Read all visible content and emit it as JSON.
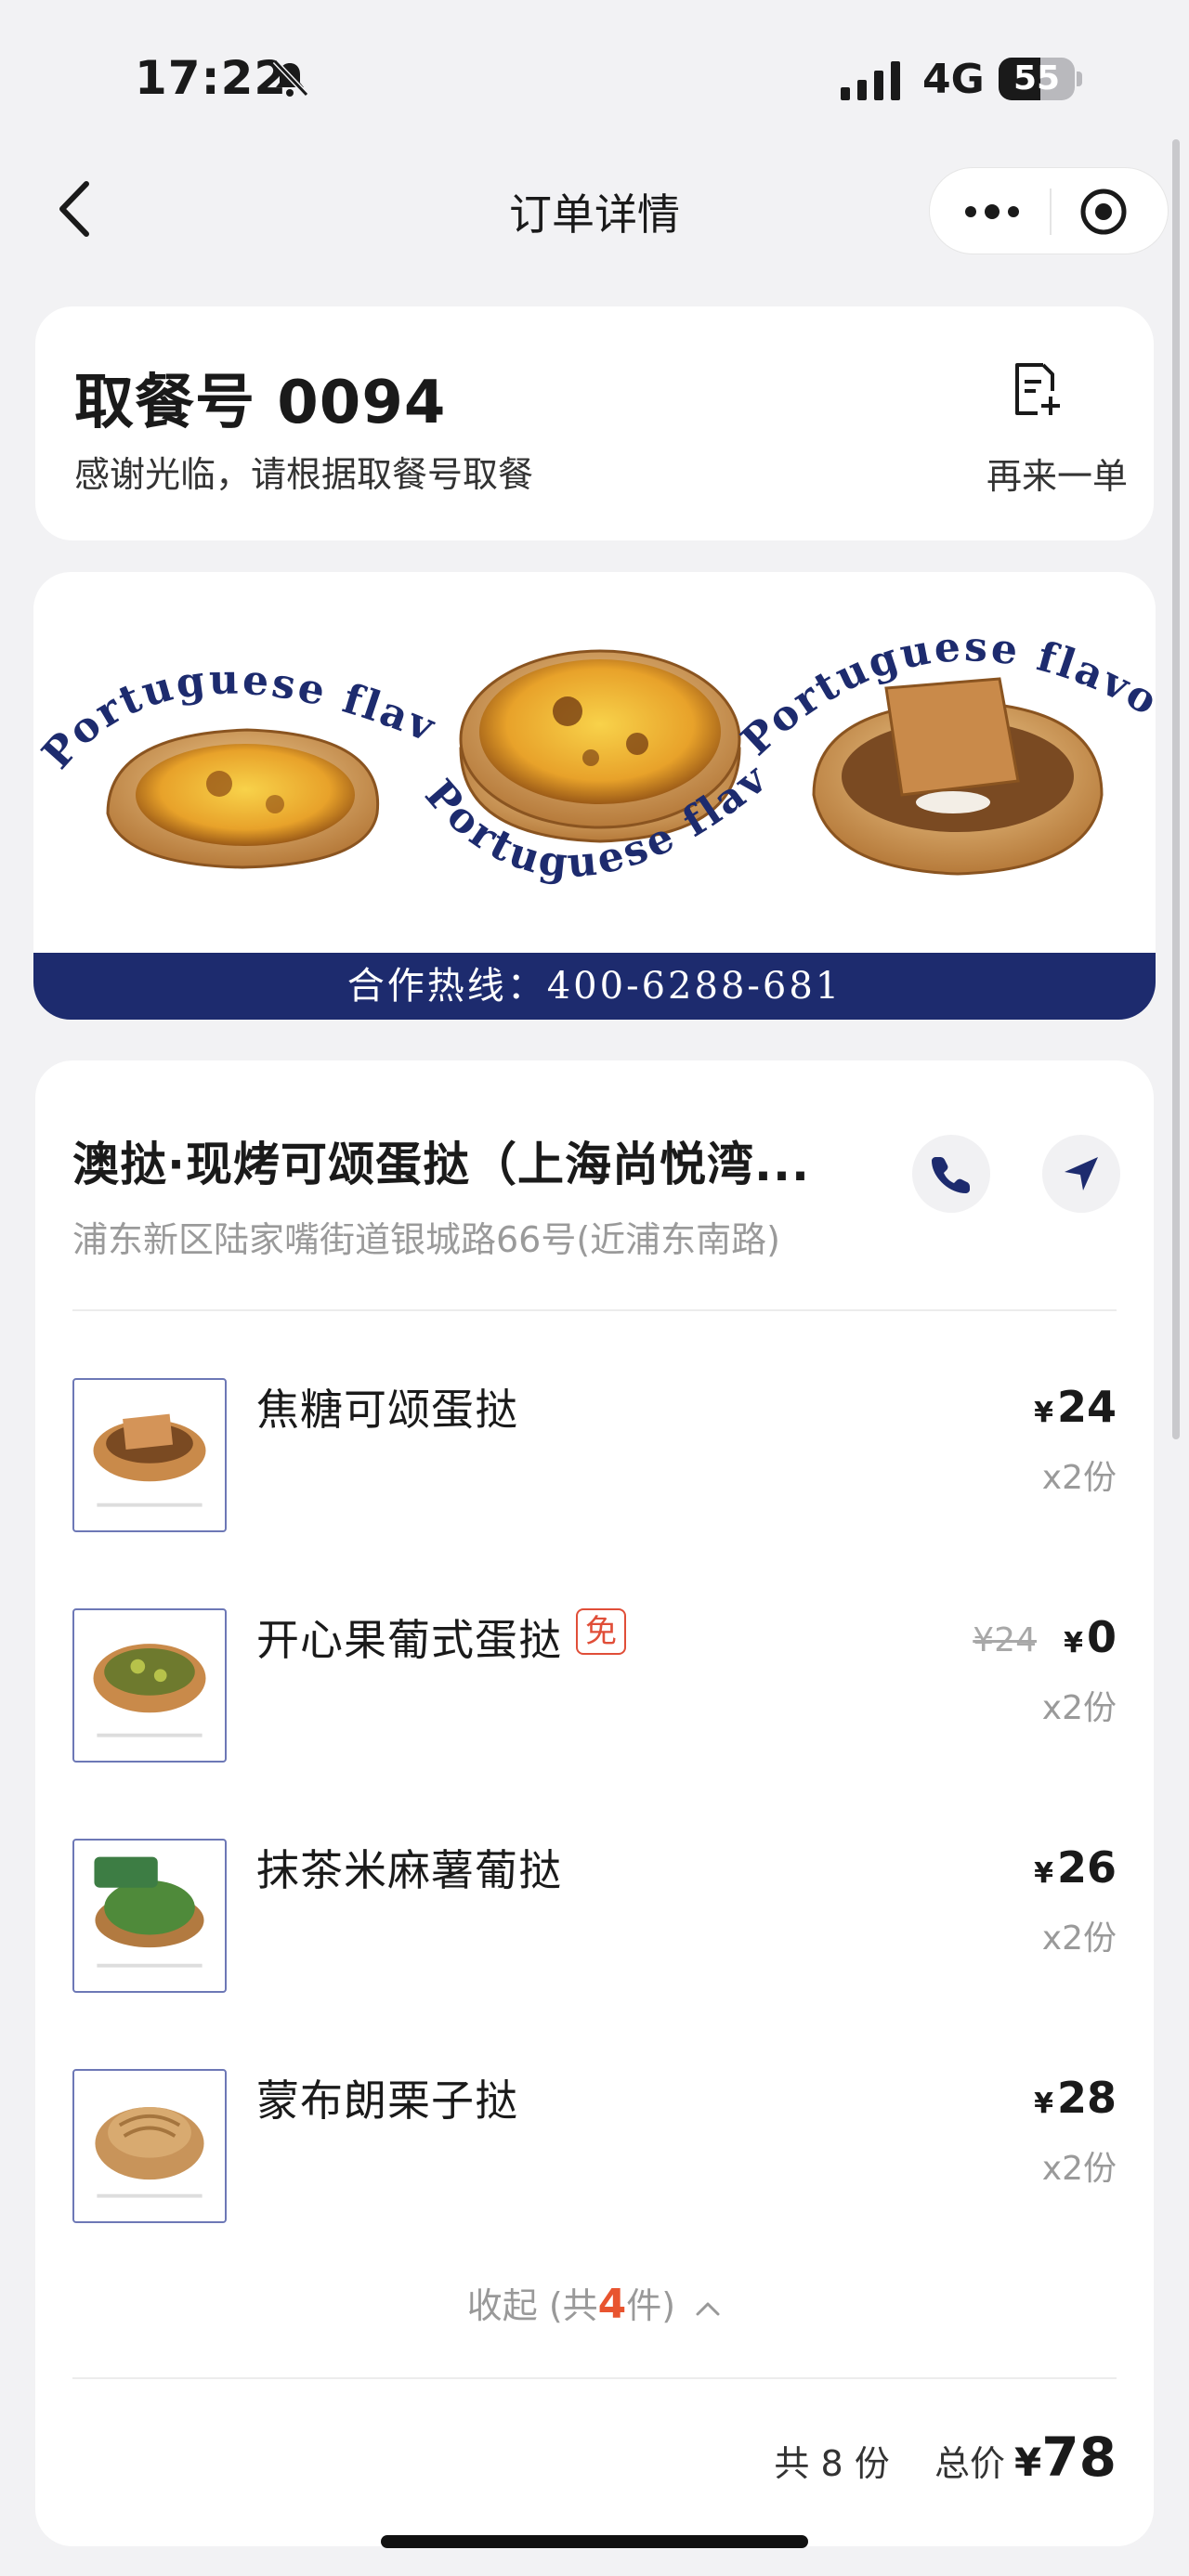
{
  "status_bar": {
    "time": "17:22",
    "network": "4G",
    "battery": "55",
    "battery_level": 0.55
  },
  "nav": {
    "title": "订单详情"
  },
  "pickup": {
    "title": "取餐号 0094",
    "subtitle": "感谢光临，请根据取餐号取餐",
    "reorder_label": "再来一单"
  },
  "banner": {
    "curved_text": "Portuguese flavour",
    "hotline": "合作热线：400-6288-681"
  },
  "store": {
    "name": "澳挞·现烤可颂蛋挞（上海尚悦湾...",
    "address": "浦东新区陆家嘴街道银城路66号(近浦东南路)"
  },
  "items": [
    {
      "name": "焦糖可颂蛋挞",
      "currency": "¥",
      "price": "24",
      "qty": "x2份"
    },
    {
      "name": "开心果葡式蛋挞",
      "tag": "免",
      "original_price": "¥24",
      "currency": "¥",
      "price": "0",
      "qty": "x2份"
    },
    {
      "name": "抹茶米麻薯葡挞",
      "currency": "¥",
      "price": "26",
      "qty": "x2份"
    },
    {
      "name": "蒙布朗栗子挞",
      "currency": "¥",
      "price": "28",
      "qty": "x2份"
    }
  ],
  "collapse": {
    "prefix": "收起 (共",
    "count": "4",
    "suffix": "件)"
  },
  "summary": {
    "count_text": "共 8 份",
    "total_label": "总价",
    "currency": "¥",
    "total": "78"
  },
  "colors": {
    "brand_navy": "#1d2b6e",
    "accent_orange": "#e8542f",
    "free_tag_red": "#e04e38"
  }
}
